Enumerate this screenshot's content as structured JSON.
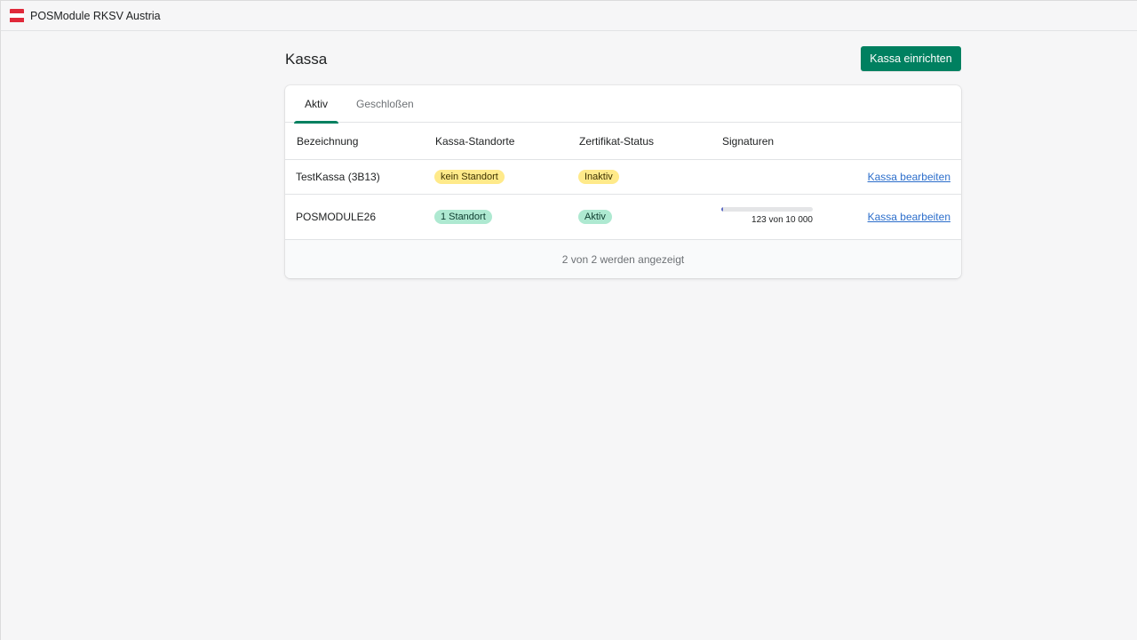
{
  "topbar": {
    "app_name": "POSModule RKSV Austria",
    "logo_icon": "austria-flag-icon",
    "flag_colors": {
      "red": "#e0293a",
      "white": "#ffffff"
    }
  },
  "page": {
    "title": "Kassa",
    "primary_action": "Kassa einrichten",
    "accent_color": "#008060"
  },
  "tabs": [
    {
      "label": "Aktiv",
      "active": true
    },
    {
      "label": "Geschloßen",
      "active": false
    }
  ],
  "table": {
    "headers": [
      "Bezeichnung",
      "Kassa-Standorte",
      "Zertifikat-Status",
      "Signaturen"
    ],
    "rows": [
      {
        "name": "TestKassa (3B13)",
        "location_badge": {
          "text": "kein Standort",
          "tone": "warning"
        },
        "cert_badge": {
          "text": "Inaktiv",
          "tone": "warning"
        },
        "signatures": null,
        "action": "Kassa bearbeiten"
      },
      {
        "name": "POSMODULE26",
        "location_badge": {
          "text": "1 Standort",
          "tone": "success"
        },
        "cert_badge": {
          "text": "Aktiv",
          "tone": "success"
        },
        "signatures": {
          "used": 123,
          "total": 10000,
          "label": "123 von 10 000"
        },
        "action": "Kassa bearbeiten"
      }
    ]
  },
  "footer": {
    "text": "2 von 2 werden angezeigt"
  }
}
